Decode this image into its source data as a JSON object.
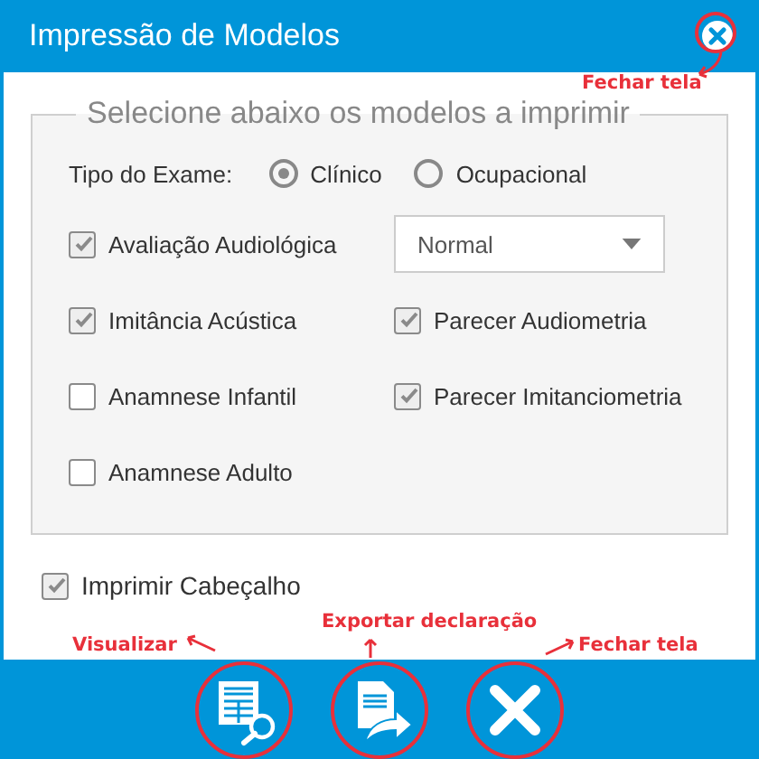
{
  "window": {
    "title": "Impressão de Modelos",
    "close_annotation": "Fechar tela"
  },
  "fieldset": {
    "legend": "Selecione abaixo os modelos a imprimir",
    "exam_type": {
      "label": "Tipo do Exame:",
      "options": [
        {
          "label": "Clínico",
          "selected": true
        },
        {
          "label": "Ocupacional",
          "selected": false
        }
      ]
    },
    "items": [
      {
        "kind": "checkbox",
        "label": "Avaliação Audiológica",
        "checked": true
      },
      {
        "kind": "select",
        "value": "Normal"
      },
      {
        "kind": "checkbox",
        "label": "Imitância Acústica",
        "checked": true
      },
      {
        "kind": "checkbox",
        "label": "Parecer Audiometria",
        "checked": true
      },
      {
        "kind": "checkbox",
        "label": "Anamnese Infantil",
        "checked": false
      },
      {
        "kind": "checkbox",
        "label": "Parecer Imitanciometria",
        "checked": true
      },
      {
        "kind": "checkbox",
        "label": "Anamnese Adulto",
        "checked": false
      }
    ]
  },
  "print_header": {
    "label": "Imprimir Cabeçalho",
    "checked": true
  },
  "buttons": [
    {
      "kind": "preview",
      "annotation": "Visualizar"
    },
    {
      "kind": "export",
      "annotation": "Exportar declaração"
    },
    {
      "kind": "close",
      "annotation": "Fechar tela"
    }
  ]
}
